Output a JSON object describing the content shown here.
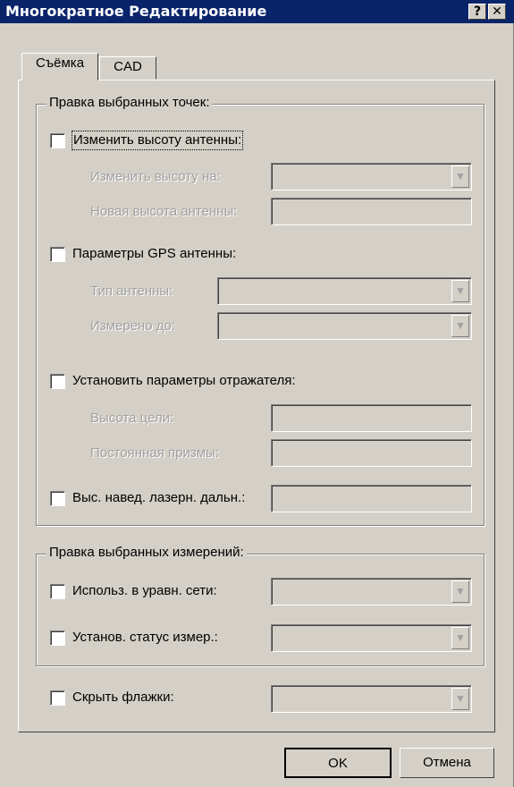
{
  "window": {
    "title": "Многократное Редактирование",
    "help_label": "?",
    "close_label": "✕"
  },
  "tabs": [
    {
      "label": "Съёмка",
      "active": true
    },
    {
      "label": "CAD",
      "active": false
    }
  ],
  "points_group": {
    "legend": "Правка выбранных точек:",
    "antenna_height": {
      "checkbox_label": "Изменить высоту антенны:",
      "change_by_label": "Изменить высоту на:",
      "change_by_value": "",
      "new_height_label": "Новая высота антенны:",
      "new_height_value": ""
    },
    "gps_antenna": {
      "checkbox_label": "Параметры GPS антенны:",
      "type_label": "Тип антенны:",
      "type_value": "",
      "measured_to_label": "Измерено до:",
      "measured_to_value": ""
    },
    "reflector": {
      "checkbox_label": "Установить параметры отражателя:",
      "target_height_label": "Высота цели:",
      "target_height_value": "",
      "prism_constant_label": "Постоянная призмы:",
      "prism_constant_value": ""
    },
    "laser": {
      "checkbox_label": "Выс. навед. лазерн. дальн.:",
      "value": ""
    }
  },
  "measurements_group": {
    "legend": "Правка выбранных измерений:",
    "use_in_adjustment": {
      "checkbox_label": "Использ. в уравн. сети:",
      "value": ""
    },
    "set_status": {
      "checkbox_label": "Установ. статус измер.:",
      "value": ""
    }
  },
  "hide_flags": {
    "checkbox_label": "Скрыть флажки:",
    "value": ""
  },
  "buttons": {
    "ok": "OK",
    "cancel": "Отмена"
  },
  "icons": {
    "dropdown_arrow": "▼"
  }
}
